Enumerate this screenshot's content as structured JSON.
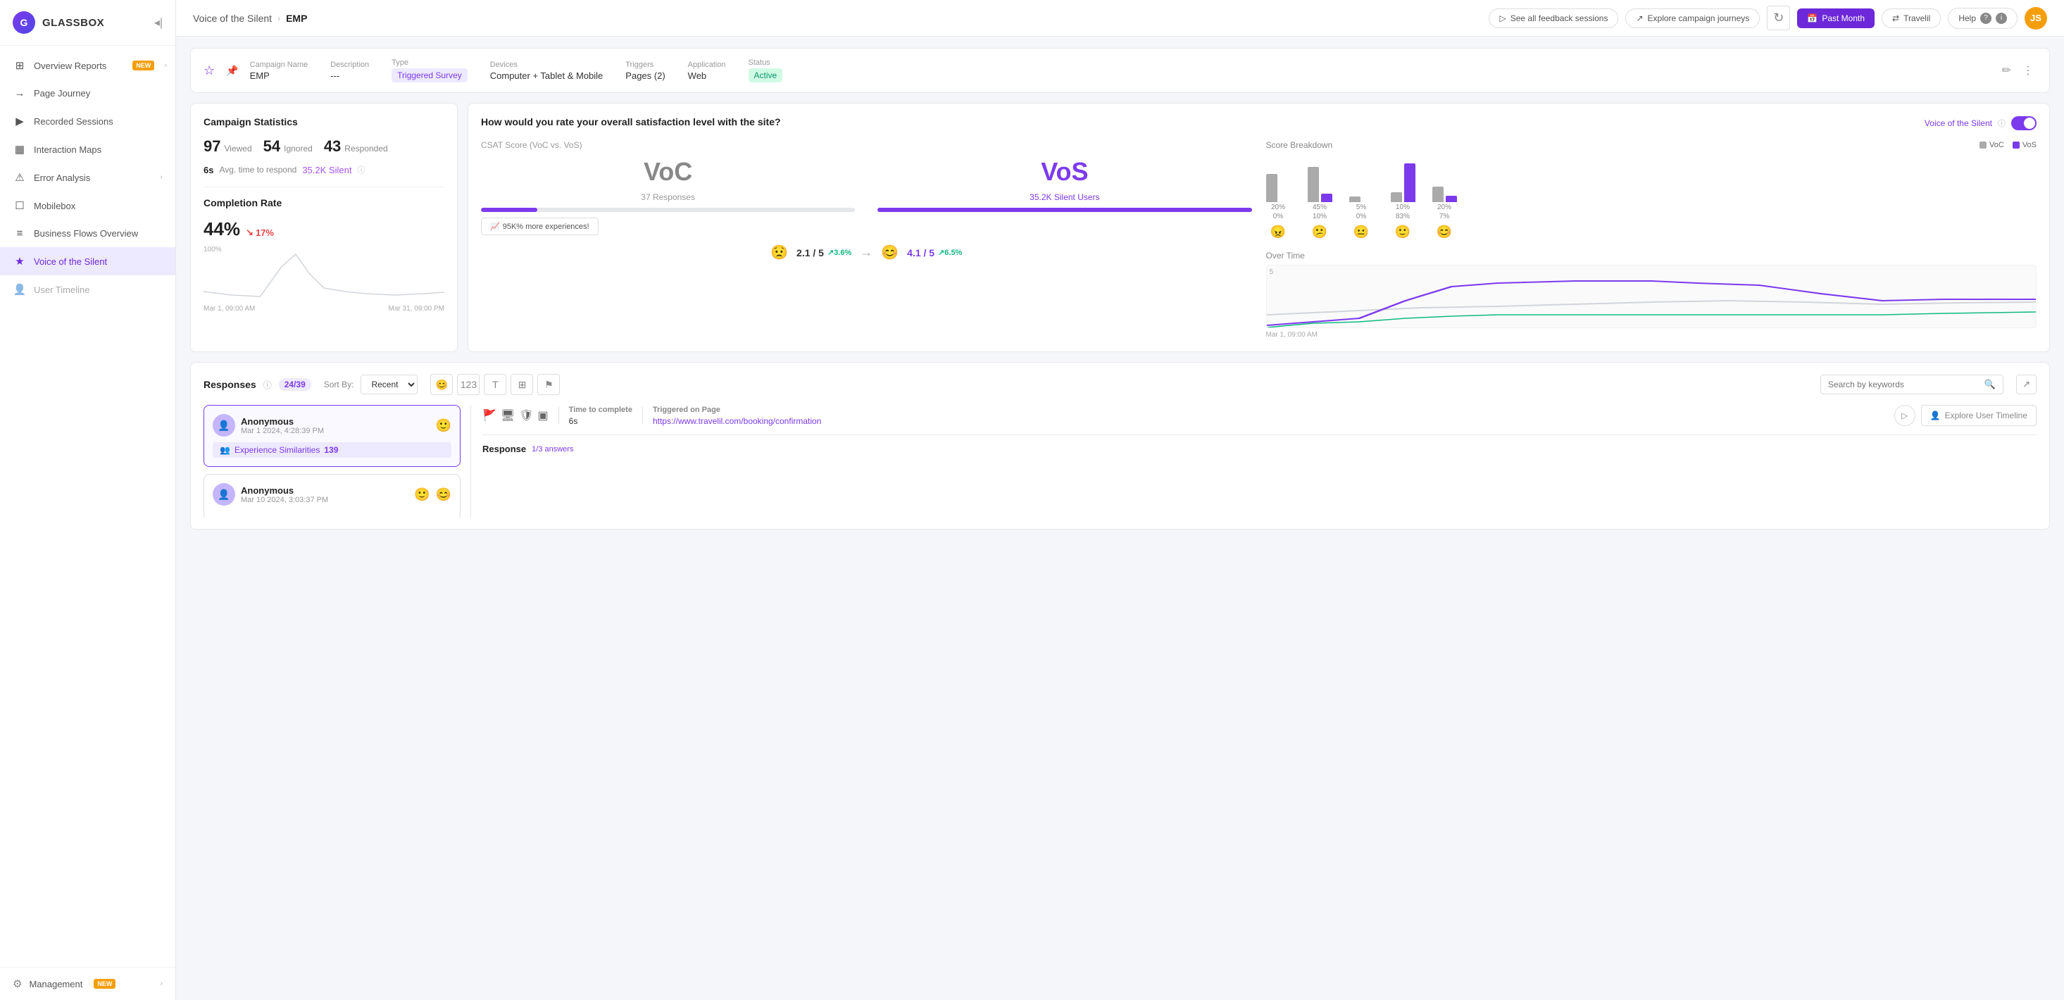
{
  "sidebar": {
    "logo": "G",
    "brand": "GLASSBOX",
    "items": [
      {
        "id": "overview-reports",
        "label": "Overview Reports",
        "icon": "⊞",
        "badge": "NEW",
        "hasChevron": true
      },
      {
        "id": "page-journey",
        "label": "Page Journey",
        "icon": "⟶"
      },
      {
        "id": "recorded-sessions",
        "label": "Recorded Sessions",
        "icon": "▶"
      },
      {
        "id": "interaction-maps",
        "label": "Interaction Maps",
        "icon": "⬜"
      },
      {
        "id": "error-analysis",
        "label": "Error Analysis",
        "icon": "⚠",
        "hasChevron": true
      },
      {
        "id": "mobilebox",
        "label": "Mobilebox",
        "icon": "📱"
      },
      {
        "id": "business-flows",
        "label": "Business Flows Overview",
        "icon": "≡"
      },
      {
        "id": "voice-of-silent",
        "label": "Voice of the Silent",
        "icon": "★",
        "active": true
      },
      {
        "id": "user-timeline",
        "label": "User Timeline",
        "icon": "👤",
        "disabled": true
      }
    ],
    "footer": {
      "label": "Management",
      "badge": "NEW"
    }
  },
  "topbar": {
    "breadcrumb_parent": "Voice of the Silent",
    "breadcrumb_current": "EMP",
    "travelil_label": "Travelil",
    "help_label": "Help",
    "avatar_initials": "JS",
    "see_feedback_label": "See all feedback sessions",
    "explore_journeys_label": "Explore campaign journeys",
    "date_range_label": "Past Month"
  },
  "campaign": {
    "name_label": "Campaign Name",
    "name_value": "EMP",
    "description_label": "Description",
    "description_value": "---",
    "type_label": "Type",
    "type_value": "Triggered Survey",
    "devices_label": "Devices",
    "devices_value": "Computer + Tablet & Mobile",
    "triggers_label": "Triggers",
    "triggers_value": "Pages (2)",
    "application_label": "Application",
    "application_value": "Web",
    "status_label": "Status",
    "status_value": "Active"
  },
  "stats": {
    "title": "Campaign Statistics",
    "viewed": 97,
    "viewed_label": "Viewed",
    "ignored": 54,
    "ignored_label": "Ignored",
    "responded": 43,
    "responded_label": "Responded",
    "avg_time": "6s",
    "avg_time_label": "Avg. time to respond",
    "silent_count": "35.2K",
    "silent_label": "Silent",
    "completion_title": "Completion Rate",
    "completion_pct": "44%",
    "completion_change": "17%",
    "chart_start": "Mar 1, 09:00 AM",
    "chart_end": "Mar 31, 09:00 PM",
    "chart_100": "100%"
  },
  "satisfaction": {
    "title": "How would you rate your overall satisfaction level with the site?",
    "vos_label": "Voice of the Silent",
    "csat_label": "CSAT Score (VoC vs. VoS)",
    "voc_label": "VoC",
    "vos_big_label": "VoS",
    "voc_responses": "37 Responses",
    "vos_silent": "35.2K Silent Users",
    "more_exp": "95K% more experiences!",
    "voc_score": "2.1 / 5",
    "voc_trend": "3.6%",
    "vos_score": "4.1 / 5",
    "vos_trend": "6.5%",
    "score_breakdown_title": "Score Breakdown",
    "legend_voc": "VoC",
    "legend_vos": "VoS",
    "breakdown_bars": [
      {
        "voc_pct": "20%",
        "vos_pct": "0%",
        "voc_h": 40,
        "vos_h": 0,
        "emoji": "😠"
      },
      {
        "voc_pct": "45%",
        "vos_pct": "10%",
        "voc_h": 50,
        "vos_h": 12,
        "emoji": "😕"
      },
      {
        "voc_pct": "5%",
        "vos_pct": "0%",
        "voc_h": 8,
        "vos_h": 0,
        "emoji": "😐"
      },
      {
        "voc_pct": "10%",
        "vos_pct": "83%",
        "voc_h": 14,
        "vos_h": 55,
        "emoji": "🙂"
      },
      {
        "voc_pct": "20%",
        "vos_pct": "7%",
        "voc_h": 22,
        "vos_h": 9,
        "emoji": "😊"
      }
    ],
    "over_time_title": "Over Time",
    "over_time_date": "Mar 1, 09:00 AM",
    "over_time_y": "5"
  },
  "responses": {
    "title": "Responses",
    "count": "24/39",
    "sort_label": "Sort By:",
    "sort_value": "Recent",
    "search_placeholder": "Search by keywords",
    "items": [
      {
        "user": "Anonymous",
        "date": "Mar 1 2024, 4:28:39 PM",
        "emoji": "🙂",
        "exp_label": "Experience Similarities",
        "exp_count": 139,
        "selected": true
      },
      {
        "user": "Anonymous",
        "date": "Mar 10 2024, 3:03:37 PM",
        "emoji1": "🙂",
        "emoji2": "😊",
        "selected": false
      }
    ],
    "detail": {
      "time_label": "Time to complete",
      "time_value": "6s",
      "triggered_label": "Triggered on Page",
      "triggered_value": "https://www.travelil.com/booking/confirmation"
    },
    "response_label": "Response",
    "response_count": "1/3 answers",
    "explore_timeline": "Explore User Timeline"
  }
}
